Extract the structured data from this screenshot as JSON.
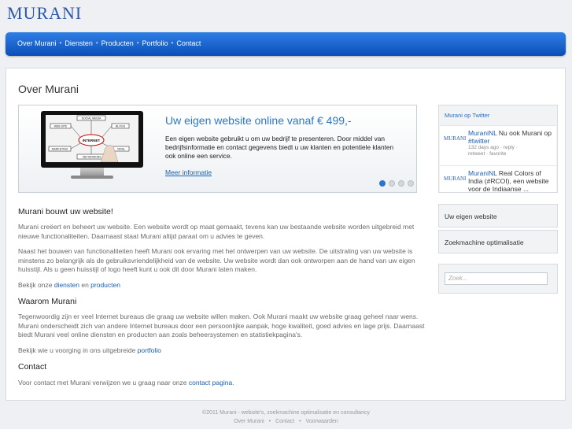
{
  "logo": "MURANI",
  "nav": {
    "items": [
      "Over Murani",
      "Diensten",
      "Producten",
      "Portfolio",
      "Contact"
    ],
    "separator": "•"
  },
  "page_title": "Over Murani",
  "slider": {
    "title": "Uw eigen website online vanaf  € 499,-",
    "text": "Een eigen website gebruikt u om uw bedrijf te presenteren. Door middel van bedrijfsinformatie en contact gegevens biedt u uw klanten en potentiele klanten ook online een service.",
    "link": "Meer informatie",
    "screen_words": [
      "WEB SITE",
      "SOCIAL MEDIA",
      "BLOGS",
      "INTERNET",
      "MARKETING",
      "VIRAL",
      "NETWORKING"
    ],
    "dots_total": 4,
    "dots_active": 1
  },
  "sections": [
    {
      "heading": "Murani bouwt uw website!",
      "paragraphs": [
        "Murani creëert en beheert uw website. Een website wordt op maat gemaakt, tevens kan uw bestaande website worden uitgebreid met nieuwe functionaliteiten. Daarnaast staat Murani altijd paraat om u advies te geven.",
        "Naast het bouwen van functionaliteiten heeft Murani ook ervaring met het ontwerpen van uw website. De uitstraling van uw website is minstens zo belangrijk als de gebruiksvriendelijkheid van de website. Uw website wordt dan ook ontworpen aan de hand van uw eigen huisstijl. Als u geen huisstijl of logo heeft kunt u ook dit door Murani laten maken."
      ],
      "links_line": {
        "prefix": "Bekijk onze ",
        "link1": "diensten",
        "mid": " en ",
        "link2": "producten"
      }
    },
    {
      "heading": "Waarom Murani",
      "paragraphs": [
        "Tegenwoordig zijn er veel Internet bureaus die graag uw website willen maken. Ook Murani maakt uw website graag geheel naar wens. Murani onderscheidt zich van andere Internet bureaus door een persoonlijke aanpak, hoge kwaliteit, goed advies en lage prijs. Daarnaast biedt Murani veel online diensten en producten aan zoals beheersystemen en statistiekpagina's."
      ],
      "links_line": {
        "prefix": "Bekijk wie u voorging in ons uitgebreide ",
        "link1": "portfolio"
      }
    },
    {
      "heading": "Contact",
      "links_line": {
        "prefix": "Voor contact met Murani verwijzen we u graag naar onze ",
        "link1": "contact pagina",
        "suffix": "."
      }
    }
  ],
  "twitter": {
    "heading": "Murani op Twitter",
    "tweets": [
      {
        "logo": "MURANI",
        "user": "MuraniNL",
        "text": " Nu ook Murani op ",
        "tag": "#twitter",
        "meta1": "132 days ago · reply ·",
        "meta2": "retweet · favorite"
      },
      {
        "logo": "MURANI",
        "user": "MuraniNL",
        "text": " Real Colors of India (#RCOI), een website voor de Indiaanse ..."
      }
    ]
  },
  "sidebar_links": [
    "Uw eigen website",
    "Zoekmachine optimalisatie"
  ],
  "search": {
    "placeholder": "Zoek..."
  },
  "footer": {
    "line1": "©2011 Murani - website's, zoekmachine optimalisatie en consultancy",
    "links": [
      "Over Murani",
      "Contact",
      "Voorwaarden"
    ],
    "separator": "•"
  },
  "colors": {
    "accent": "#1a5fb0",
    "nav": "#0a4fb8",
    "logo": "#2a5aa8"
  }
}
